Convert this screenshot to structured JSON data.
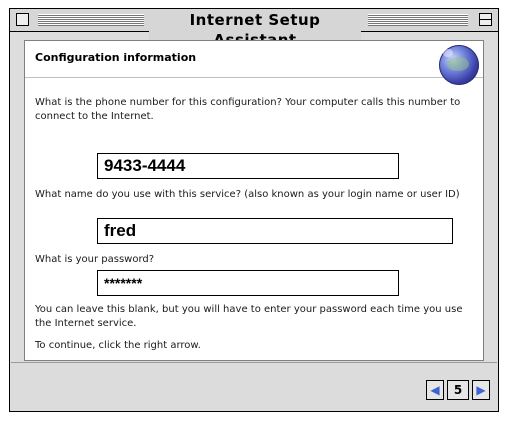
{
  "window": {
    "title": "Internet Setup Assistant"
  },
  "section": {
    "title": "Configuration information"
  },
  "phone": {
    "prompt": "What is the phone number for this configuration? Your computer calls this number to connect to the Internet.",
    "value": "9433-4444"
  },
  "username": {
    "prompt": "What name do you use with this service? (also known as your login name or user ID)",
    "value": "fred"
  },
  "password": {
    "prompt": "What is your password?",
    "value": "*******"
  },
  "note": "You can leave this blank, but you will have to enter your password each time you use the Internet service.",
  "continue_text": "To continue, click the right arrow.",
  "navigation": {
    "prev_glyph": "◀",
    "page": "5",
    "next_glyph": "▶"
  },
  "icons": {
    "globe": "globe-icon",
    "close": "close-box-icon",
    "zoom": "zoom-box-icon"
  },
  "colors": {
    "arrow": "#3b62d6"
  }
}
